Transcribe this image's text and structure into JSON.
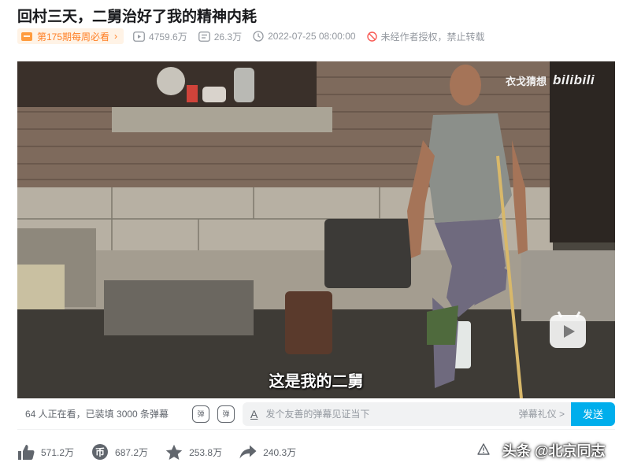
{
  "video": {
    "title": "回村三天，二舅治好了我的精神内耗"
  },
  "meta": {
    "weekly_badge": "第175期每周必看",
    "views": "4759.6万",
    "danmaku_count": "26.3万",
    "pubdate": "2022-07-25 08:00:00",
    "copyright": "未经作者授权，禁止转载"
  },
  "player": {
    "watermark_uploader": "衣戈猜想",
    "watermark_brand": "bilibili",
    "subtitle": "这是我的二舅"
  },
  "danmaku_bar": {
    "viewers_text": "64 人正在看，已装填 3000 条弹幕",
    "input_placeholder": "发个友善的弹幕见证当下",
    "etiquette": "弹幕礼仪 >",
    "send_label": "发送"
  },
  "actions": {
    "like": "571.2万",
    "coin": "687.2万",
    "favorite": "253.8万",
    "share": "240.3万"
  },
  "overlay": {
    "toutiao": "头条 @北京同志"
  },
  "colors": {
    "accent": "#00aeec",
    "weekly_orange": "#ff7f24",
    "copyright_red": "#f85a54",
    "meta_gray": "#9499a0"
  }
}
